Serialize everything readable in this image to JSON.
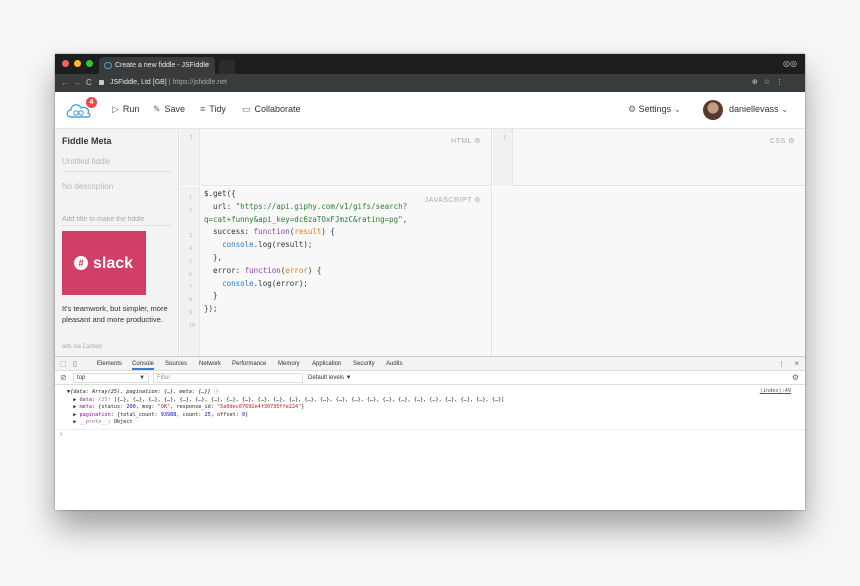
{
  "browser": {
    "tab_title": "Create a new fiddle - JSFiddle",
    "tab_close": "×",
    "site_name": "JSFiddle, Ltd [GB]",
    "url": "https://jsfiddle.net",
    "back": "←",
    "forward": "→",
    "reload": "C"
  },
  "header": {
    "badge_count": "4",
    "run_label": "Run",
    "save_label": "Save",
    "tidy_label": "Tidy",
    "collaborate_label": "Collaborate",
    "settings_label": "Settings",
    "username": "daniellevass"
  },
  "sidebar": {
    "title": "Fiddle Meta",
    "title_placeholder": "Untitled fiddle",
    "description_placeholder": "No description",
    "tags_placeholder": "Add title to make the fiddle",
    "ad_brand": "slack",
    "ad_text": "It's teamwork, but simpler, more pleasant and more productive.",
    "ad_via": "ads via Carbon"
  },
  "panels": {
    "html_label": "HTML",
    "css_label": "CSS",
    "js_label": "JAVASCRIPT"
  },
  "devtools": {
    "tabs": [
      "Elements",
      "Console",
      "Sources",
      "Network",
      "Performance",
      "Memory",
      "Application",
      "Security",
      "Audits"
    ],
    "active_tab": "Console",
    "context": "top",
    "filter_placeholder": "Filter",
    "levels": "Default levels ▼",
    "source_link": "(index):49"
  },
  "colors": {
    "accent": "#3b78e7",
    "badge": "#e64a4a",
    "slack_bg": "#d13f67",
    "titlebar": "#1e1e1e"
  }
}
